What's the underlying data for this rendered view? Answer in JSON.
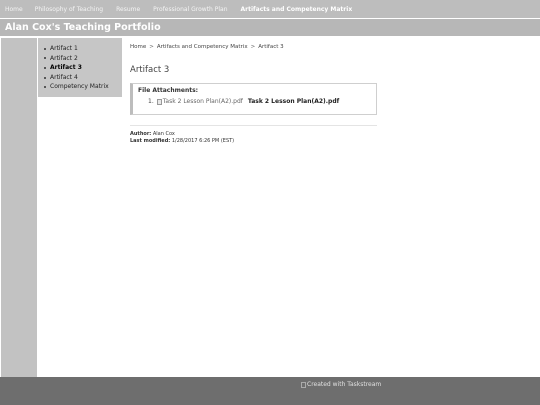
{
  "topnav": {
    "items": [
      {
        "label": "Home"
      },
      {
        "label": "Philosophy of Teaching"
      },
      {
        "label": "Resume"
      },
      {
        "label": "Professional Growth Plan"
      },
      {
        "label": "Artifacts and Competency Matrix"
      }
    ]
  },
  "site": {
    "title": "Alan Cox's Teaching Portfolio"
  },
  "subnav": {
    "items": [
      {
        "label": "Artifact 1"
      },
      {
        "label": "Artifact 2"
      },
      {
        "label": "Artifact 3"
      },
      {
        "label": "Artifact 4"
      },
      {
        "label": "Competency Matrix"
      }
    ]
  },
  "breadcrumb": {
    "items": [
      "Home",
      "Artifacts and Competency Matrix",
      "Artifact 3"
    ],
    "separator": ">"
  },
  "page": {
    "title": "Artifact 3"
  },
  "attachments": {
    "heading": "File Attachments:",
    "items": [
      {
        "number": "1.",
        "image_alt": "Task 2 Lesson Plan(A2).pdf",
        "link": "Task 2 Lesson Plan(A2).pdf"
      }
    ]
  },
  "meta": {
    "author_label": "Author:",
    "author": "Alan Cox",
    "modified_label": "Last modified:",
    "modified": "1/28/2017 6:26 PM (EST)"
  },
  "footer": {
    "badge_alt": "Created with Taskstream"
  }
}
